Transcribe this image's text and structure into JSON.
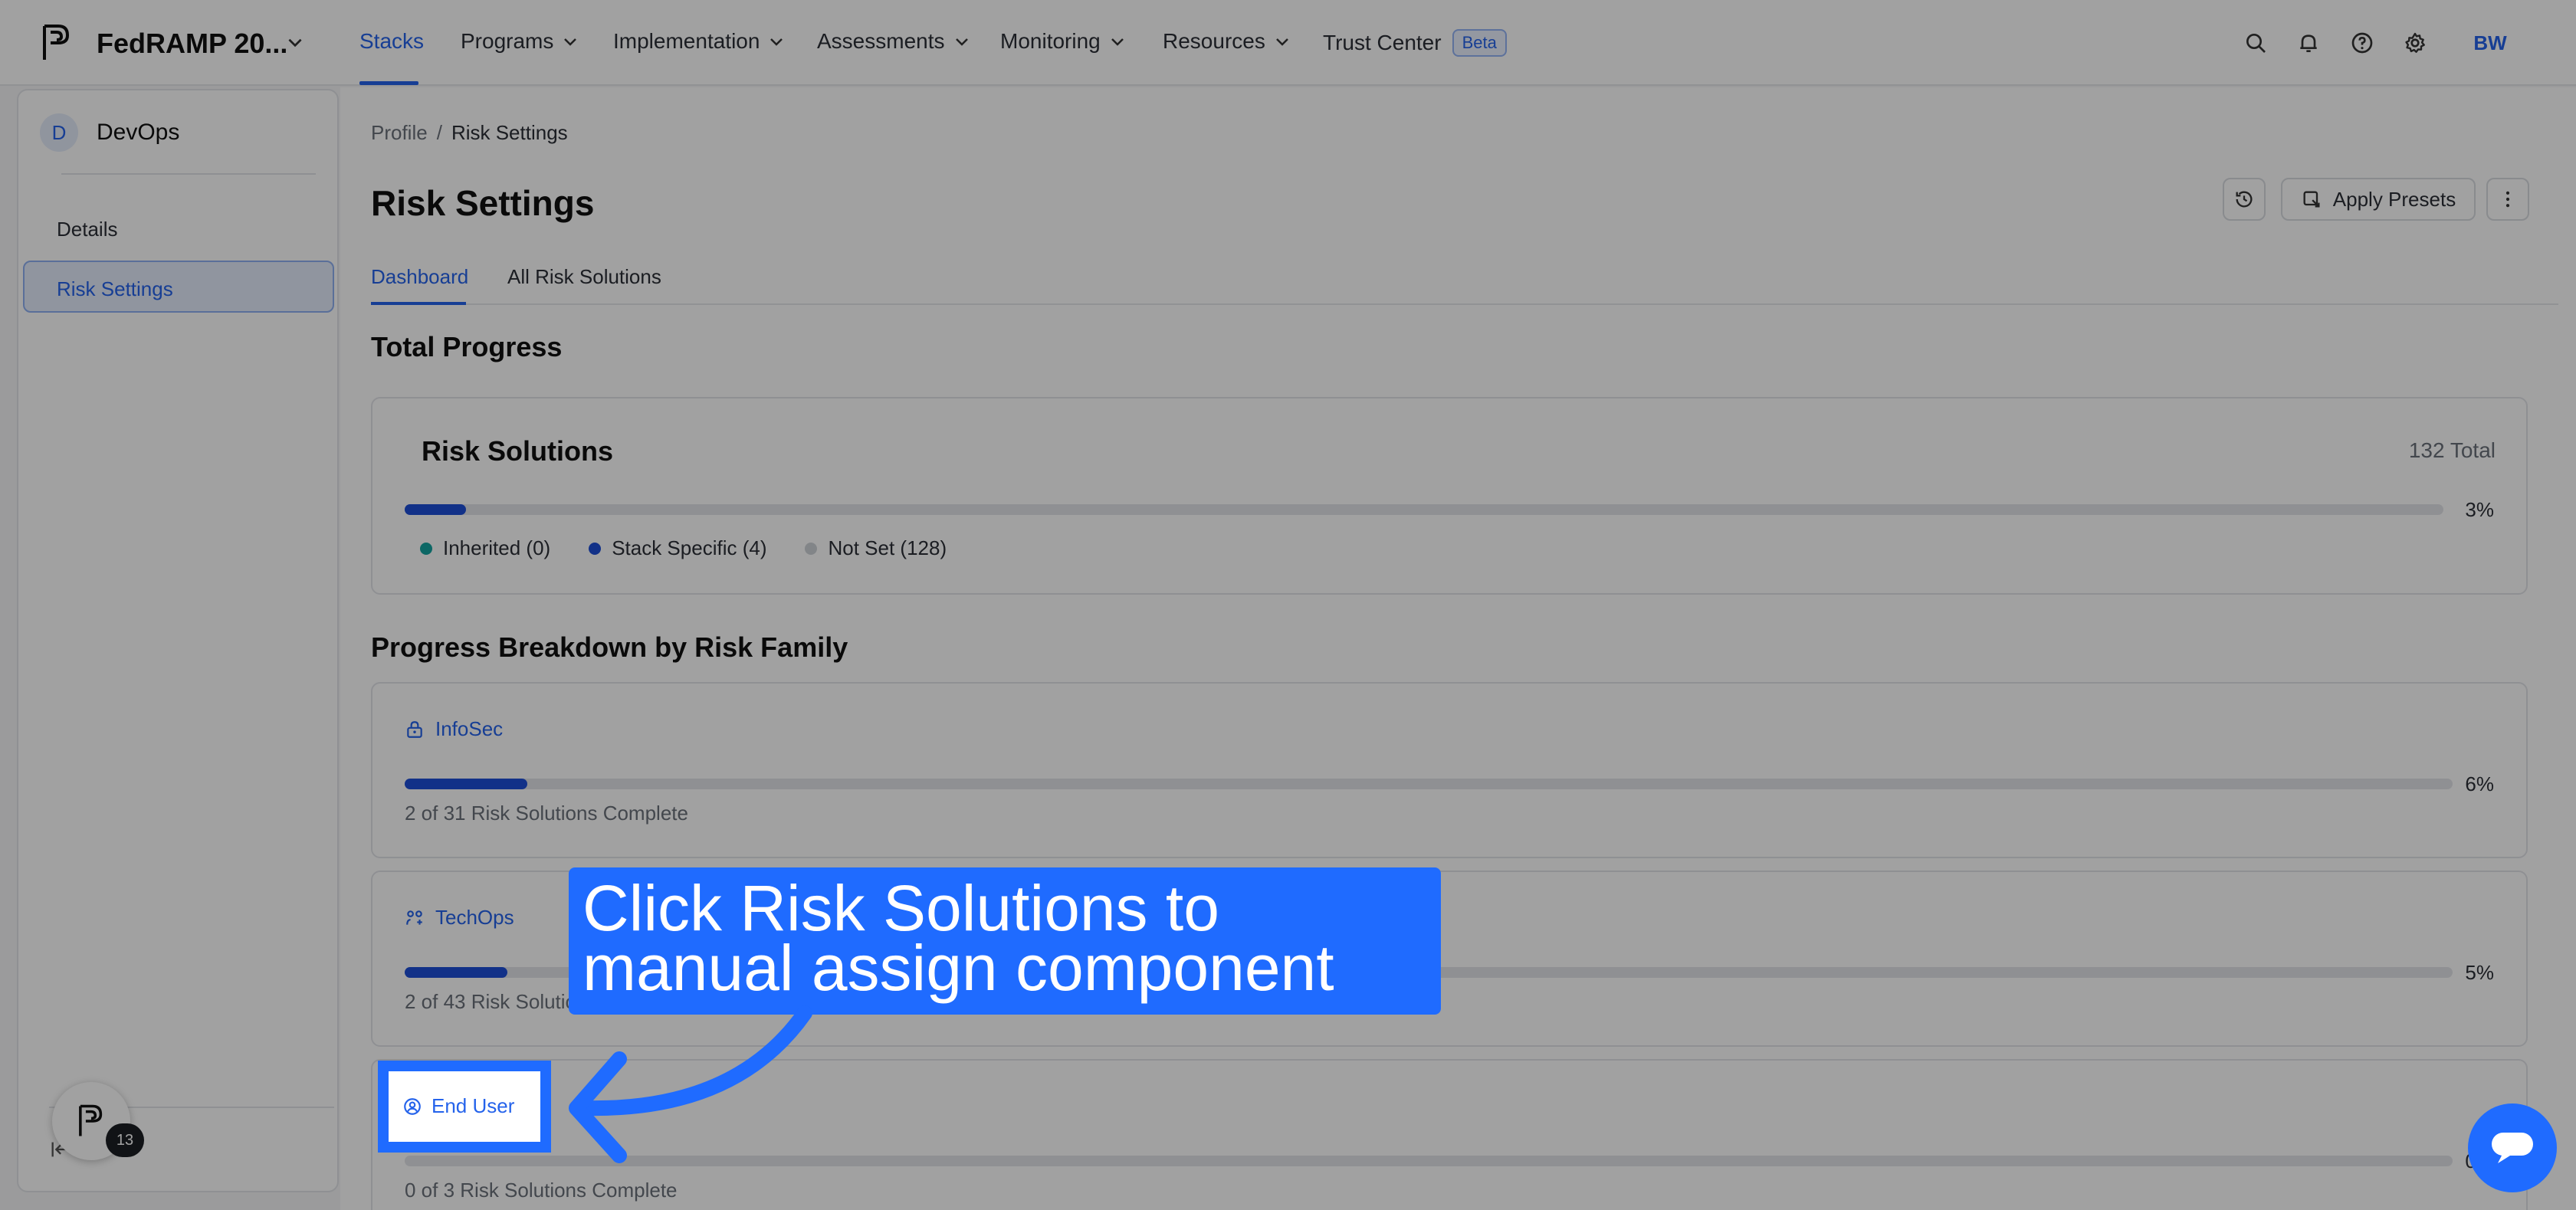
{
  "workspace": {
    "name": "FedRAMP 20..."
  },
  "nav": {
    "items": [
      {
        "label": "Stacks"
      },
      {
        "label": "Programs"
      },
      {
        "label": "Implementation"
      },
      {
        "label": "Assessments"
      },
      {
        "label": "Monitoring"
      },
      {
        "label": "Resources"
      },
      {
        "label": "Trust Center"
      }
    ],
    "beta_badge": "Beta",
    "user_initials": "BW"
  },
  "sidebar": {
    "badge": "D",
    "title": "DevOps",
    "items": [
      {
        "label": "Details"
      },
      {
        "label": "Risk Settings"
      }
    ],
    "helper_count": "13"
  },
  "breadcrumb": {
    "parent": "Profile",
    "separator": "/",
    "current": "Risk Settings"
  },
  "page": {
    "title": "Risk Settings",
    "apply_presets_label": "Apply Presets"
  },
  "tabs": [
    {
      "label": "Dashboard"
    },
    {
      "label": "All Risk Solutions"
    }
  ],
  "total_progress": {
    "heading": "Total Progress",
    "card_title": "Risk Solutions",
    "total": "132 Total",
    "percent_label": "3%",
    "percent": 3,
    "legend": [
      {
        "label": "Inherited (0)",
        "color": "#14a3a0"
      },
      {
        "label": "Stack Specific (4)",
        "color": "#1e4fd8"
      },
      {
        "label": "Not Set (128)",
        "color": "#cfd3d8"
      }
    ]
  },
  "breakdown": {
    "heading": "Progress Breakdown by Risk Family",
    "families": [
      {
        "name": "InfoSec",
        "icon": "lock-person-icon",
        "percent_label": "6%",
        "percent": 6,
        "status": "2 of 31 Risk Solutions Complete"
      },
      {
        "name": "TechOps",
        "icon": "people-gear-icon",
        "percent_label": "5%",
        "percent": 5,
        "status": "2 of 43 Risk Solutions Complete"
      },
      {
        "name": "End User",
        "icon": "user-circle-icon",
        "percent_label": "0%",
        "percent": 0,
        "status": "0 of 3 Risk Solutions Complete"
      }
    ]
  },
  "overlay": {
    "callout_text": "Click Risk Solutions to manual assign component",
    "accent": "#1f6bff"
  }
}
